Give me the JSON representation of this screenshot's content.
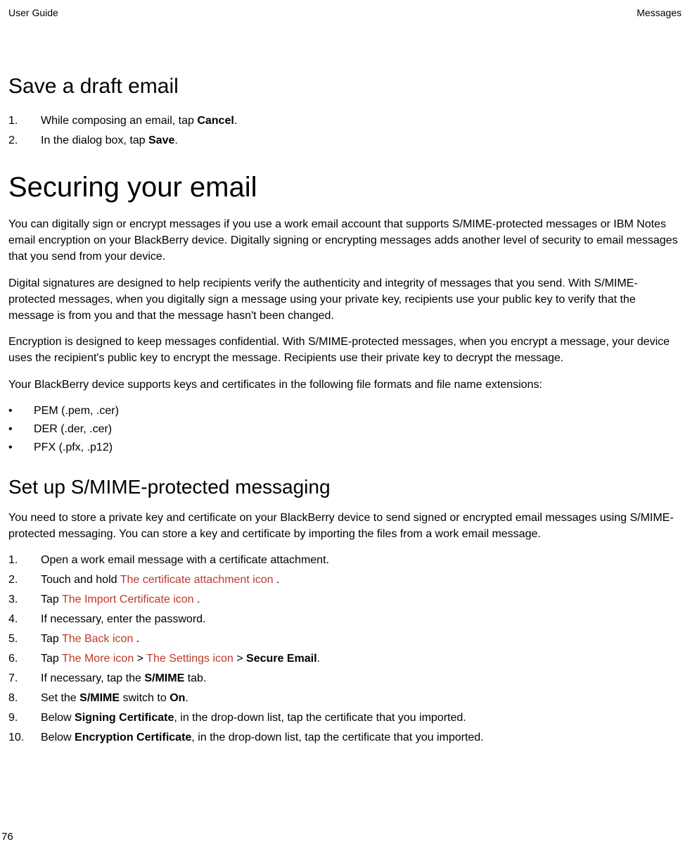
{
  "header": {
    "left": "User Guide",
    "right": "Messages"
  },
  "section1": {
    "title": "Save a draft email",
    "steps": {
      "s1_pre": "While composing an email, tap ",
      "s1_bold": "Cancel",
      "s1_post": ".",
      "s2_pre": "In the dialog box, tap ",
      "s2_bold": "Save",
      "s2_post": "."
    }
  },
  "section2": {
    "title": "Securing your email",
    "p1": "You can digitally sign or encrypt messages if you use a work email account that supports S/MIME-protected messages or IBM Notes email encryption on your BlackBerry device. Digitally signing or encrypting messages adds another level of security to email messages that you send from your device.",
    "p2": "Digital signatures are designed to help recipients verify the authenticity and integrity of messages that you send. With S/MIME-protected messages, when you digitally sign a message using your private key, recipients use your public key to verify that the message is from you and that the message hasn't been changed.",
    "p3": "Encryption is designed to keep messages confidential. With S/MIME-protected messages, when you encrypt a message, your device uses the recipient's public key to encrypt the message. Recipients use their private key to decrypt the message.",
    "p4": "Your BlackBerry device supports keys and certificates in the following file formats and file name extensions:",
    "formats": [
      "PEM (.pem, .cer)",
      "DER (.der, .cer)",
      "PFX (.pfx, .p12)"
    ]
  },
  "section3": {
    "title": "Set up S/MIME-protected messaging",
    "intro": "You need to store a private key and certificate on your BlackBerry device to send signed or encrypted email messages using S/MIME-protected messaging. You can store a key and certificate by importing the files from a work email message.",
    "steps": {
      "s1": "Open a work email message with a certificate attachment.",
      "s2_pre": "Touch and hold  ",
      "s2_icon": "The certificate attachment icon",
      "s2_post": " .",
      "s3_pre": "Tap  ",
      "s3_icon": "The Import Certificate icon",
      "s3_post": " .",
      "s4": "If necessary, enter the password.",
      "s5_pre": "Tap  ",
      "s5_icon": "The Back icon",
      "s5_post": " .",
      "s6_pre": "Tap  ",
      "s6_icon1": "The More icon",
      "s6_sep1": "  >  ",
      "s6_icon2": "The Settings icon",
      "s6_sep2": "  > ",
      "s6_bold": "Secure Email",
      "s6_post": ".",
      "s7_pre": "If necessary, tap the ",
      "s7_bold": "S/MIME",
      "s7_post": " tab.",
      "s8_pre": "Set the ",
      "s8_bold1": "S/MIME",
      "s8_mid": " switch to ",
      "s8_bold2": "On",
      "s8_post": ".",
      "s9_pre": "Below ",
      "s9_bold": "Signing Certificate",
      "s9_post": ", in the drop-down list, tap the certificate that you imported.",
      "s10_pre": "Below ",
      "s10_bold": "Encryption Certificate",
      "s10_post": ", in the drop-down list, tap the certificate that you imported."
    }
  },
  "page_number": "76"
}
